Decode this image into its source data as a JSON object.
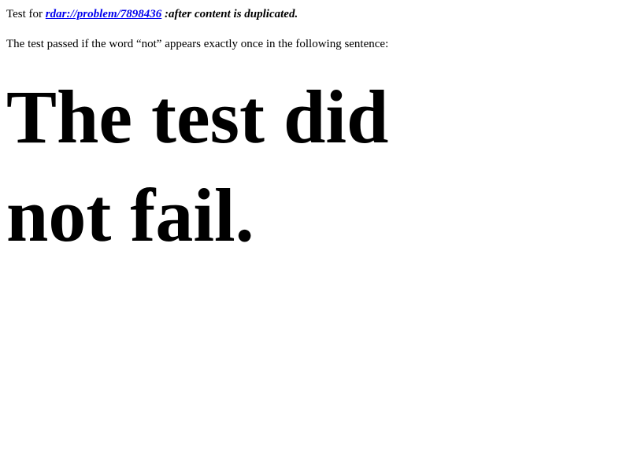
{
  "header": {
    "prefix": "Test for ",
    "link_text": "rdar://problem/7898436",
    "suffix": " :after content is duplicated."
  },
  "instruction": "The test passed if the word “not” appears exactly once in the following sentence:",
  "sentence": "The test did not fail.",
  "colors": {
    "link": "#0000ee",
    "text": "#000000",
    "background": "#ffffff"
  }
}
